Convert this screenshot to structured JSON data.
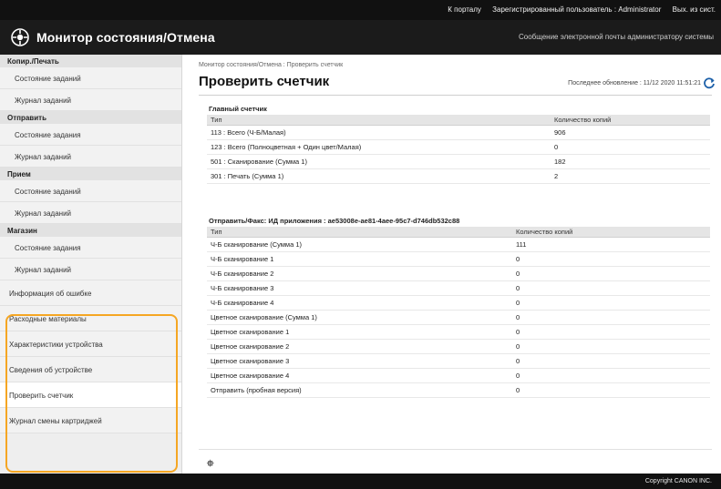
{
  "top_links": {
    "portal": "К порталу",
    "user": "Зарегистрированный пользователь :  Administrator",
    "logout": "Вых. из сист."
  },
  "header": {
    "title": "Монитор состояния/Отмена",
    "mail_link": "Сообщение электронной почты администратору системы"
  },
  "sidebar": {
    "copy_print": {
      "title": "Копир./Печать",
      "items": [
        "Состояние заданий",
        "Журнал заданий"
      ]
    },
    "send": {
      "title": "Отправить",
      "items": [
        "Состояние задания",
        "Журнал заданий"
      ]
    },
    "receive": {
      "title": "Прием",
      "items": [
        "Состояние заданий",
        "Журнал заданий"
      ]
    },
    "store": {
      "title": "Магазин",
      "items": [
        "Состояние задания",
        "Журнал заданий"
      ]
    },
    "extra": [
      "Информация об ошибке",
      "Расходные материалы",
      "Характеристики устройства",
      "Сведения об устройстве",
      "Проверить счетчик",
      "Журнал смены картриджей"
    ],
    "active_item": "Проверить счетчик"
  },
  "main": {
    "breadcrumb": "Монитор состояния/Отмена : Проверить счетчик",
    "title": "Проверить счетчик",
    "last_update": "Последнее обновление : 11/12 2020 11:51:21",
    "main_counter": {
      "title": "Главный счетчик",
      "headers": [
        "Тип",
        "Количество копий"
      ],
      "rows": [
        [
          "113 : Всего (Ч-Б/Малая)",
          "906"
        ],
        [
          "123 : Всего (Полноцветная + Один цвет/Малая)",
          "0"
        ],
        [
          "501 : Сканирование (Сумма 1)",
          "182"
        ],
        [
          "301 : Печать (Сумма 1)",
          "2"
        ]
      ]
    },
    "send_counter": {
      "title": "Отправить/Факс: ИД приложения : ae53008e-ae81-4aee-95c7-d746db532c88",
      "headers": [
        "Тип",
        "Количество копий"
      ],
      "rows": [
        [
          "Ч-Б сканирование (Сумма 1)",
          "111"
        ],
        [
          "Ч-Б сканирование 1",
          "0"
        ],
        [
          "Ч-Б сканирование 2",
          "0"
        ],
        [
          "Ч-Б сканирование 3",
          "0"
        ],
        [
          "Ч-Б сканирование 4",
          "0"
        ],
        [
          "Цветное сканирование (Сумма 1)",
          "0"
        ],
        [
          "Цветное сканирование 1",
          "0"
        ],
        [
          "Цветное сканирование 2",
          "0"
        ],
        [
          "Цветное сканирование 3",
          "0"
        ],
        [
          "Цветное сканирование 4",
          "0"
        ],
        [
          "Отправить (пробная версия)",
          "0"
        ]
      ]
    },
    "top_icon": "⯐"
  },
  "footer": {
    "copyright": "Copyright CANON INC."
  },
  "colors": {
    "highlight": "#f5a623",
    "topbar": "#111111",
    "header": "#1b1b1b",
    "sidebar": "#eeeeee"
  }
}
